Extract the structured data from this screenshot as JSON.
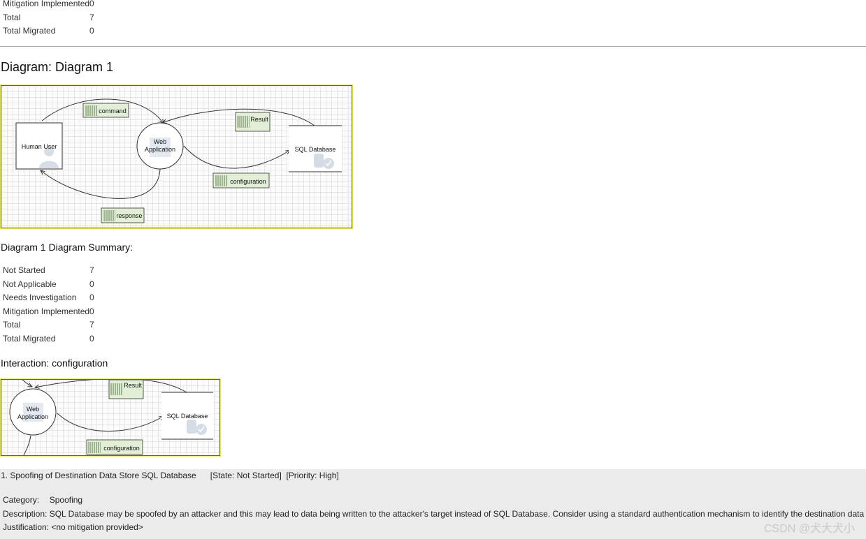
{
  "top_summary": {
    "rows": [
      {
        "label": "Mitigation Implemented",
        "value": "0"
      },
      {
        "label": "Total",
        "value": "7"
      },
      {
        "label": "Total Migrated",
        "value": "0"
      }
    ]
  },
  "diagram": {
    "heading": "Diagram: Diagram 1",
    "nodes": {
      "human_user": "Human User",
      "web_app_line1": "Web",
      "web_app_line2": "Application",
      "sql_db": "SQL Database"
    },
    "flows": {
      "command": "command",
      "result": "Result",
      "configuration": "configuration",
      "response": "response"
    }
  },
  "diagram_summary": {
    "heading": "Diagram 1 Diagram Summary:",
    "rows": [
      {
        "label": "Not Started",
        "value": "7"
      },
      {
        "label": "Not Applicable",
        "value": "0"
      },
      {
        "label": "Needs Investigation",
        "value": "0"
      },
      {
        "label": "Mitigation Implemented",
        "value": "0"
      },
      {
        "label": "Total",
        "value": "7"
      },
      {
        "label": "Total Migrated",
        "value": "0"
      }
    ]
  },
  "interaction": {
    "heading": "Interaction: configuration",
    "nodes": {
      "web_app_line1": "Web",
      "web_app_line2": "Application",
      "sql_db": "SQL Database"
    },
    "flows": {
      "result": "Result",
      "configuration": "configuration"
    }
  },
  "threat": {
    "title": "1. Spoofing of Destination Data Store SQL Database      [State: Not Started]  [Priority: High]",
    "category_label": "Category:",
    "category_value": "Spoofing",
    "description_label": "Description:",
    "description_value": "SQL Database may be spoofed by an attacker and this may lead to data being written to the attacker's target instead of SQL Database. Consider using a standard authentication mechanism to identify the destination data store.",
    "justification_label": "Justification:",
    "justification_value": "<no mitigation provided>"
  },
  "watermark": "CSDN @犬大犬小",
  "colors": {
    "frame_border": "#6b6b00",
    "flow_label_bg": "#e2efd6",
    "threat_bg": "#ebebeb"
  }
}
